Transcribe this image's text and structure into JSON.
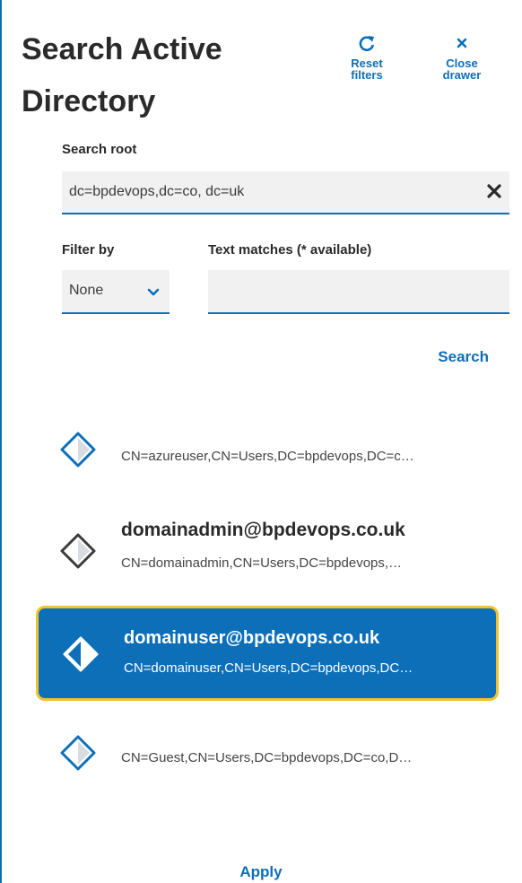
{
  "title_line1": "Search Active",
  "title_line2": "Directory",
  "actions": {
    "reset_label_1": "Reset",
    "reset_label_2": "filters",
    "close_label_1": "Close",
    "close_label_2": "drawer"
  },
  "search_root": {
    "label": "Search root",
    "value": "dc=bpdevops,dc=co, dc=uk"
  },
  "filter": {
    "label": "Filter by",
    "selected": "None"
  },
  "text_matches": {
    "label": "Text matches (* available)",
    "value": ""
  },
  "search_button": "Search",
  "results": [
    {
      "name": "",
      "dn": "CN=azureuser,CN=Users,DC=bpdevops,DC=c…",
      "selected": false,
      "icon": "user-diamond-icon"
    },
    {
      "name": "domainadmin@bpdevops.co.uk",
      "dn": "CN=domainadmin,CN=Users,DC=bpdevops,…",
      "selected": false,
      "icon": "user-diamond-icon"
    },
    {
      "name": "domainuser@bpdevops.co.uk",
      "dn": "CN=domainuser,CN=Users,DC=bpdevops,DC…",
      "selected": true,
      "icon": "user-diamond-icon"
    },
    {
      "name": "",
      "dn": "CN=Guest,CN=Users,DC=bpdevops,DC=co,D…",
      "selected": false,
      "icon": "user-diamond-icon"
    }
  ],
  "apply_button": "Apply",
  "colors": {
    "accent": "#0d6fb8",
    "selected_border": "#f2c22e"
  }
}
